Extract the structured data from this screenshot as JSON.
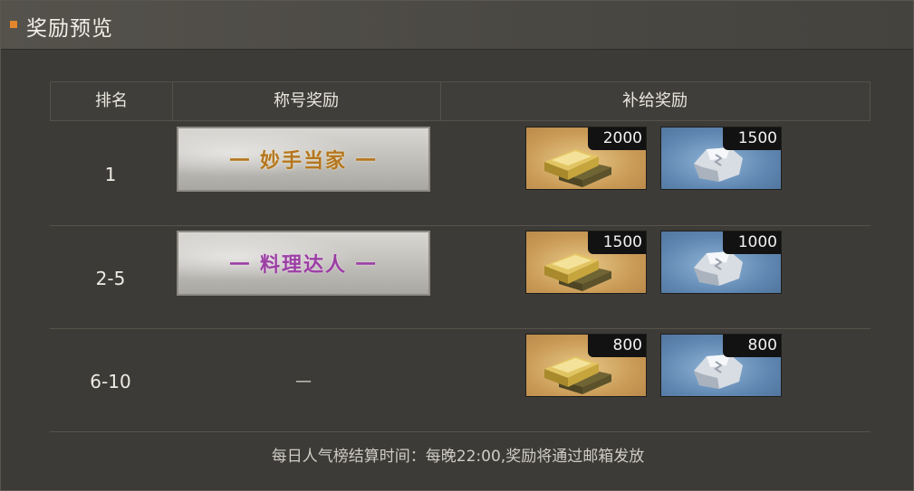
{
  "header": {
    "title": "奖励预览"
  },
  "table": {
    "headers": {
      "rank": "排名",
      "title_reward": "称号奖励",
      "supply_reward": "补给奖励"
    },
    "rows": [
      {
        "rank": "1",
        "title": "一 妙手当家 一",
        "title_color": "#b4761e",
        "gold": "2000",
        "silver": "1500"
      },
      {
        "rank": "2-5",
        "title": "一 料理达人 一",
        "title_color": "#9b3fa4",
        "gold": "1500",
        "silver": "1000"
      },
      {
        "rank": "6-10",
        "title": "—",
        "gold": "800",
        "silver": "800"
      }
    ]
  },
  "icons": {
    "gold": "gold-bar-icon",
    "silver": "silver-ore-icon"
  },
  "footer": {
    "note": "每日人气榜结算时间：每晚22:00,奖励将通过邮箱发放"
  }
}
